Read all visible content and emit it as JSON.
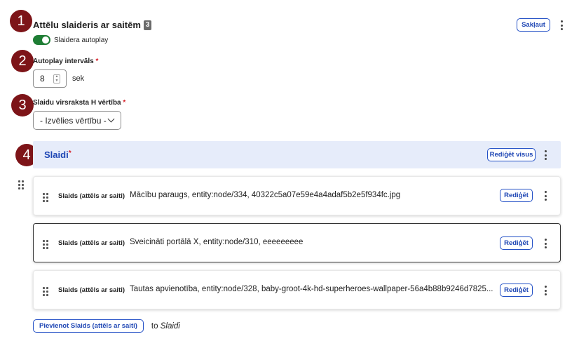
{
  "header": {
    "title": "Attēlu slaideris ar saitēm",
    "count": "3",
    "collapse_label": "Sakļaut"
  },
  "autoplay_toggle": {
    "label": "Slaidera autoplay",
    "on": true
  },
  "interval": {
    "label": "Autoplay intervāls",
    "required": "*",
    "value": "8",
    "unit": "sek"
  },
  "heading_select": {
    "label": "Slaidu virsraksta H vērtība",
    "required": "*",
    "selected": "- Izvēlies vērtību -"
  },
  "slides_section": {
    "title": "Slaidi",
    "required": "*",
    "edit_all_label": "Rediģēt visus"
  },
  "slides": [
    {
      "type": "Slaids (attēls ar saiti)",
      "description": "Mācību paraugs, entity:node/334, 40322c5a07e59e4a4adaf5b2e5f934fc.jpg",
      "edit_label": "Rediģēt"
    },
    {
      "type": "Slaids (attēls ar saiti)",
      "description": "Sveicināti portālā X, entity:node/310, eeeeeeeee",
      "edit_label": "Rediģēt"
    },
    {
      "type": "Slaids (attēls ar saiti)",
      "description": "Tautas apvienotība, entity:node/328, baby-groot-4k-hd-superheroes-wallpaper-56a4b88b9246d7825...",
      "edit_label": "Rediģēt"
    }
  ],
  "add": {
    "button_label": "Pievienot Slaids (attēls ar saiti)",
    "to_prefix": "to",
    "to_target": "Slaidi"
  },
  "callouts": [
    "1",
    "2",
    "3",
    "4"
  ],
  "colors": {
    "accent": "#1e46b4",
    "callout": "#7d1418",
    "toggle_on": "#1e7d34",
    "section_bg": "#e6ecfa",
    "required": "#d6212a"
  },
  "icons": [
    "kebab-menu-icon",
    "drag-handle-icon",
    "chevron-down-icon",
    "spinner-arrows-icon"
  ]
}
